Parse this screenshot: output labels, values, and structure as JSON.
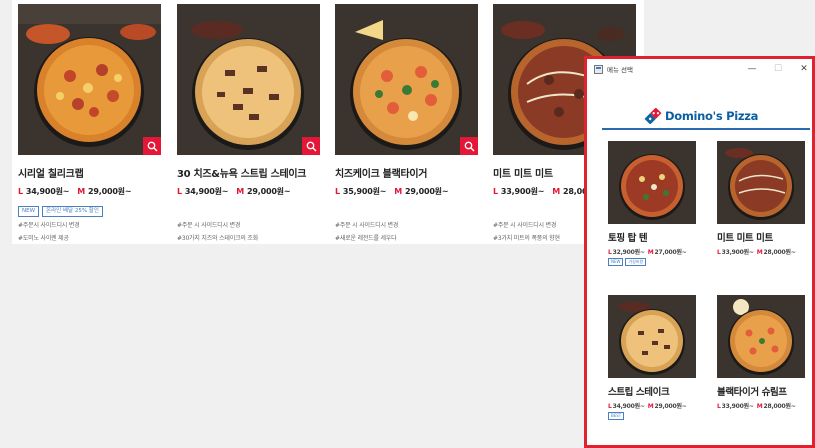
{
  "background": {
    "products": [
      {
        "name": "시리얼 칠리크랩",
        "price_large": "34,900원~",
        "price_medium": "29,000원~",
        "badges": [
          "NEW",
          "온라인 배달 25% 할인"
        ],
        "tags": [
          "#주문시 사이드디시 변경",
          "#도미노 사이렌 제공"
        ]
      },
      {
        "name": "30 치즈&뉴욕 스트립 스테이크",
        "price_large": "34,900원~",
        "price_medium": "29,000원~",
        "badges": [],
        "tags": [
          "#주문 시 사이드디시 변경",
          "#30가지 치즈와 스테이크의 조화"
        ]
      },
      {
        "name": "치즈케이크 블랙타이거",
        "price_large": "35,900원~",
        "price_medium": "29,000원~",
        "badges": [],
        "tags": [
          "#주문 시 사이드디시 변경",
          "#새로운 레전드를 세우다"
        ]
      },
      {
        "name": "미트 미트 미트",
        "price_large": "33,900원~",
        "price_medium": "28,00",
        "badges": [],
        "tags": [
          "#주문 시 사이드디시 변경",
          "#3가지 미트의 폭풍의 향현"
        ]
      }
    ],
    "size_large": "L",
    "size_medium": "M"
  },
  "window": {
    "title": "메뉴 선택",
    "brand": "Domino's Pizza",
    "minimize": "—",
    "maximize": "☐",
    "close": "✕",
    "items": [
      {
        "name": "토핑 탑 텐",
        "price_large": "32,900원~",
        "price_medium": "27,000원~",
        "badges": [
          "NEW",
          "가성비왕"
        ]
      },
      {
        "name": "미트 미트 미트",
        "price_large": "33,900원~",
        "price_medium": "28,000원~",
        "badges": []
      },
      {
        "name": "스트립 스테이크",
        "price_large": "34,900원~",
        "price_medium": "29,000원~",
        "badges": [
          "BEST"
        ]
      },
      {
        "name": "블랙타이거 슈림프",
        "price_large": "33,900원~",
        "price_medium": "28,000원~",
        "badges": []
      }
    ]
  },
  "colors": {
    "accent_red": "#e31837",
    "window_border": "#e0222e",
    "brand_blue": "#0b5fa2",
    "badge_blue": "#4a7fc1"
  },
  "icons": {
    "zoom": "search-icon",
    "brand_logo": "dominos-logo-icon",
    "app": "window-app-icon"
  }
}
